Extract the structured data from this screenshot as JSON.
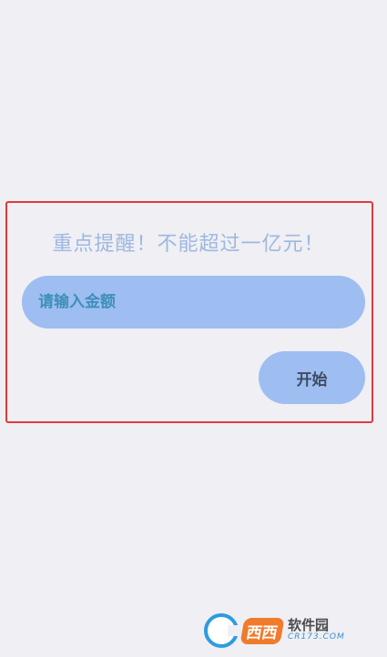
{
  "dialog": {
    "warning_text": "重点提醒！不能超过一亿元！",
    "amount_placeholder": "请输入金额",
    "amount_value": "",
    "start_label": "开始"
  },
  "watermark": {
    "brand": "西西",
    "title": "软件园",
    "subtitle": "CR173.COM"
  },
  "colors": {
    "background": "#efeff4",
    "highlight_border": "#e23a3a",
    "pill_fill": "#9ebdf1",
    "warning_text": "#9eb8df"
  }
}
